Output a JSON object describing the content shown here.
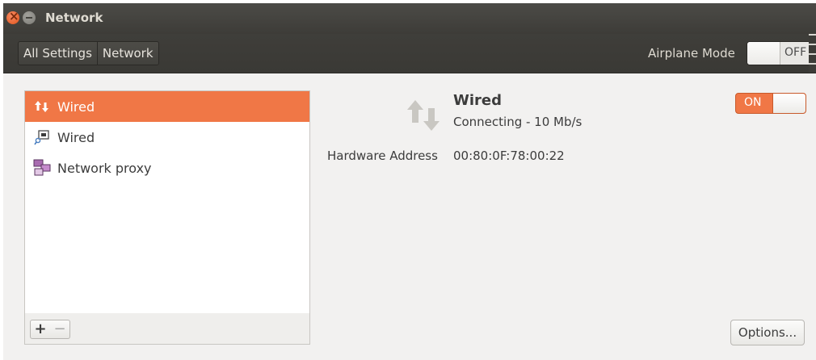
{
  "window": {
    "title": "Network"
  },
  "toolbar": {
    "breadcrumbs": [
      "All Settings",
      "Network"
    ],
    "airplane_mode_label": "Airplane Mode",
    "airplane_mode_state": "OFF"
  },
  "sidebar": {
    "items": [
      {
        "label": "Wired",
        "icon": "wired-arrows-icon",
        "selected": true
      },
      {
        "label": "Wired",
        "icon": "network-device-icon",
        "selected": false
      },
      {
        "label": "Network proxy",
        "icon": "network-proxy-icon",
        "selected": false
      }
    ],
    "add_label": "+",
    "remove_label": "−"
  },
  "detail": {
    "title": "Wired",
    "status": "Connecting - 10 Mb/s",
    "hardware_address_label": "Hardware Address",
    "hardware_address_value": "00:80:0F:78:00:22",
    "switch_state": "ON",
    "options_label": "Options..."
  },
  "colors": {
    "accent": "#f07746",
    "titlebar": "#3d3c38",
    "window_bg": "#f2f1f0"
  }
}
